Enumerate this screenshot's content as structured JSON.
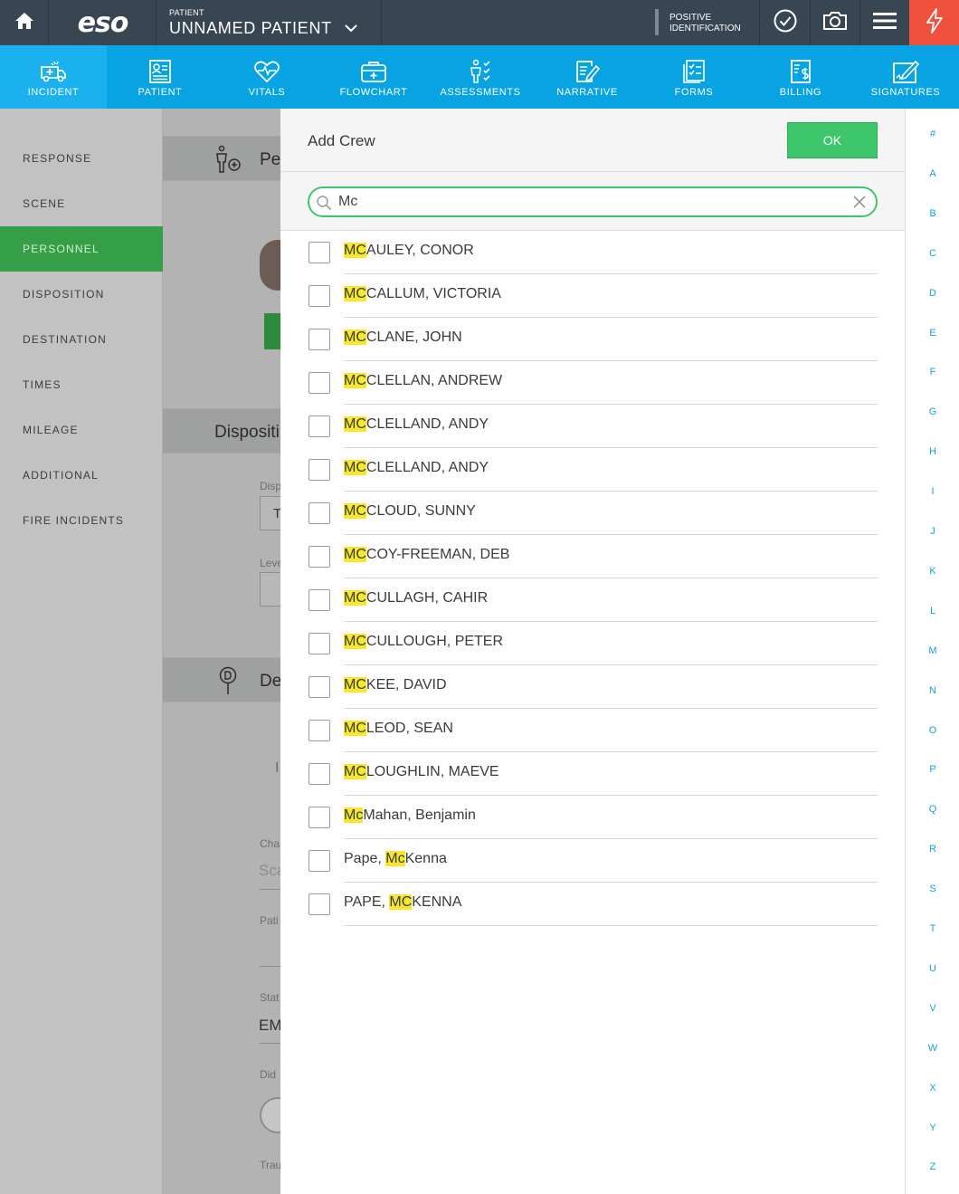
{
  "header": {
    "logo": "eso",
    "patient_caption": "PATIENT",
    "patient_name": "UNNAMED PATIENT",
    "positive_id_line1": "POSITIVE",
    "positive_id_line2": "IDENTIFICATION"
  },
  "colors": {
    "topbar": "#384553",
    "navbar": "#08a3e2",
    "accent_green": "#3dc76a",
    "alert": "#f0513f",
    "highlight": "#f6e62c"
  },
  "nav": {
    "items": [
      {
        "label": "INCIDENT",
        "icon": "ambulance-icon"
      },
      {
        "label": "PATIENT",
        "icon": "patient-chart-icon"
      },
      {
        "label": "VITALS",
        "icon": "heart-pulse-icon"
      },
      {
        "label": "FLOWCHART",
        "icon": "medical-kit-icon"
      },
      {
        "label": "ASSESSMENTS",
        "icon": "assessment-body-icon"
      },
      {
        "label": "NARRATIVE",
        "icon": "narrative-pen-icon"
      },
      {
        "label": "FORMS",
        "icon": "forms-checklist-icon"
      },
      {
        "label": "BILLING",
        "icon": "billing-dollar-icon"
      },
      {
        "label": "SIGNATURES",
        "icon": "signature-icon"
      }
    ],
    "active": "INCIDENT"
  },
  "sidebar": {
    "items": [
      {
        "label": "RESPONSE"
      },
      {
        "label": "SCENE"
      },
      {
        "label": "PERSONNEL"
      },
      {
        "label": "DISPOSITION"
      },
      {
        "label": "DESTINATION"
      },
      {
        "label": "TIMES"
      },
      {
        "label": "MILEAGE"
      },
      {
        "label": "ADDITIONAL"
      },
      {
        "label": "FIRE INCIDENTS"
      }
    ],
    "active": "PERSONNEL"
  },
  "background": {
    "personnel_title": "Pe",
    "disposition_title": "Dispositi",
    "destination_title": "De",
    "disp_label": "Disp",
    "disp_value": "T",
    "level_label": "Leve",
    "dest_value": "I",
    "cha_label": "Cha",
    "sca_value": "Sca",
    "pati_label": "Pati",
    "stat_label": "Stat",
    "em_value": "EM",
    "did_label": "Did",
    "trau_label": "Trau"
  },
  "modal": {
    "title": "Add Crew",
    "ok_label": "OK",
    "search_value": "Mc",
    "search_placeholder": "Search",
    "crew": [
      {
        "pre": "",
        "match": "MC",
        "post": "AULEY, CONOR"
      },
      {
        "pre": "",
        "match": "MC",
        "post": "CALLUM, VICTORIA"
      },
      {
        "pre": "",
        "match": "MC",
        "post": "CLANE, JOHN"
      },
      {
        "pre": "",
        "match": "MC",
        "post": "CLELLAN, ANDREW"
      },
      {
        "pre": "",
        "match": "MC",
        "post": "CLELLAND, ANDY"
      },
      {
        "pre": "",
        "match": "MC",
        "post": "CLELLAND, ANDY"
      },
      {
        "pre": "",
        "match": "MC",
        "post": "CLOUD, SUNNY"
      },
      {
        "pre": "",
        "match": "MC",
        "post": "COY-FREEMAN, DEB"
      },
      {
        "pre": "",
        "match": "MC",
        "post": "CULLAGH, CAHIR"
      },
      {
        "pre": "",
        "match": "MC",
        "post": "CULLOUGH, PETER"
      },
      {
        "pre": "",
        "match": "MC",
        "post": "KEE, DAVID"
      },
      {
        "pre": "",
        "match": "MC",
        "post": "LEOD, SEAN"
      },
      {
        "pre": "",
        "match": "MC",
        "post": "LOUGHLIN, MAEVE"
      },
      {
        "pre": "",
        "match": "Mc",
        "post": "Mahan, Benjamin"
      },
      {
        "pre": "Pape, ",
        "match": "Mc",
        "post": "Kenna"
      },
      {
        "pre": "PAPE, ",
        "match": "MC",
        "post": "KENNA"
      }
    ]
  },
  "alphabet": [
    "#",
    "A",
    "B",
    "C",
    "D",
    "E",
    "F",
    "G",
    "H",
    "I",
    "J",
    "K",
    "L",
    "M",
    "N",
    "O",
    "P",
    "Q",
    "R",
    "S",
    "T",
    "U",
    "V",
    "W",
    "X",
    "Y",
    "Z"
  ]
}
